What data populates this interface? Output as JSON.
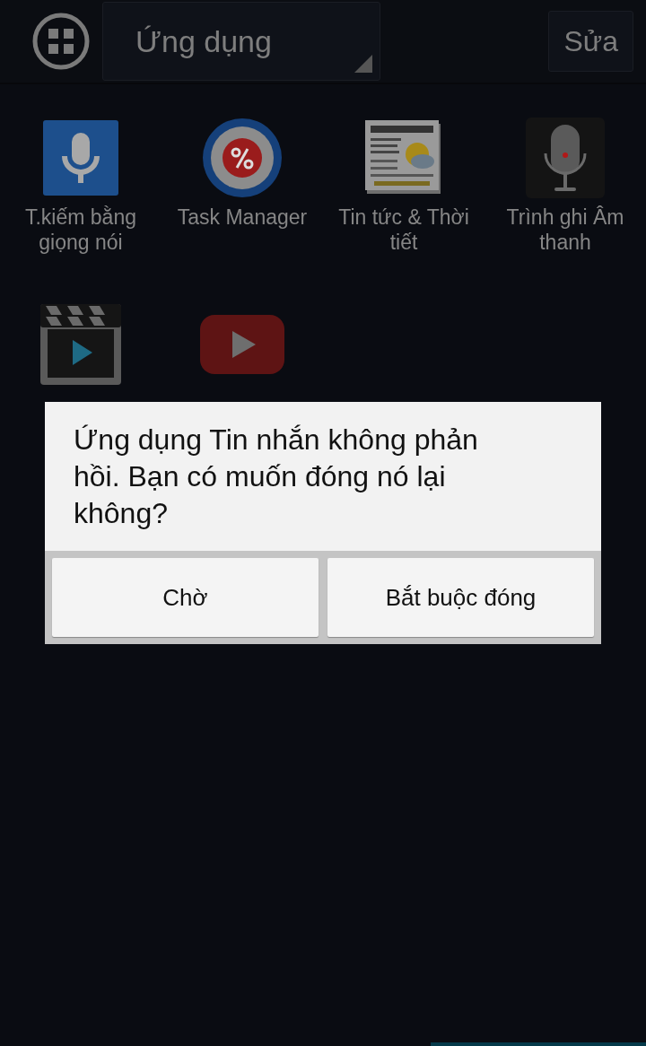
{
  "top_bar": {
    "category": "Ứng dụng",
    "edit_button": "Sửa"
  },
  "apps": [
    {
      "label": "T.kiếm bằng giọng nói",
      "kind": "voice"
    },
    {
      "label": "Task Manager",
      "kind": "task"
    },
    {
      "label": "Tin tức & Thời tiết",
      "kind": "news"
    },
    {
      "label": "Trình ghi Âm thanh",
      "kind": "recorder"
    },
    {
      "kind": "video"
    },
    {
      "kind": "youtube"
    }
  ],
  "dialog": {
    "message": "Ứng dụng Tin nhắn không phản hồi. Bạn có muốn đóng nó lại không?",
    "buttons": [
      "Chờ",
      "Bắt buộc đóng"
    ]
  }
}
